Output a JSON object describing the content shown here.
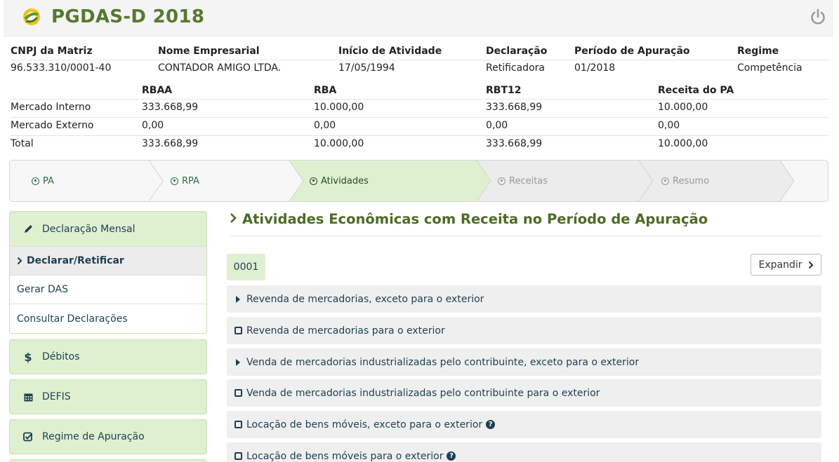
{
  "header": {
    "title": "PGDAS-D 2018",
    "logo_icon": "simples-nacional-logo",
    "power_icon": "power-icon",
    "accent": "#557a2f"
  },
  "info": {
    "headers": [
      "CNPJ da Matriz",
      "Nome Empresarial",
      "Início de Atividade",
      "Declaração",
      "Período de Apuração",
      "Regime"
    ],
    "values": [
      "96.533.310/0001-40",
      "CONTADOR AMIGO LTDA.",
      "17/05/1994",
      "Retificadora",
      "01/2018",
      "Competência"
    ]
  },
  "revenue": {
    "headers": [
      "RBAA",
      "RBA",
      "RBT12",
      "Receita do PA"
    ],
    "rows": [
      {
        "label": "Mercado Interno",
        "values": [
          "333.668,99",
          "10.000,00",
          "333.668,99",
          "10.000,00"
        ]
      },
      {
        "label": "Mercado Externo",
        "values": [
          "0,00",
          "0,00",
          "0,00",
          "0,00"
        ]
      },
      {
        "label": "Total",
        "values": [
          "333.668,99",
          "10.000,00",
          "333.668,99",
          "10.000,00"
        ]
      }
    ]
  },
  "steps": [
    {
      "label": "PA",
      "state": "done"
    },
    {
      "label": "RPA",
      "state": "done"
    },
    {
      "label": "Atividades",
      "state": "active"
    },
    {
      "label": "Receitas",
      "state": "todo"
    },
    {
      "label": "Resumo",
      "state": "todo"
    }
  ],
  "sidebar": {
    "declaracao": {
      "label": "Declaração Mensal",
      "icon": "pencil-icon"
    },
    "sub_items": [
      {
        "label": "Declarar/Retificar",
        "current": true
      },
      {
        "label": "Gerar DAS",
        "current": false
      },
      {
        "label": "Consultar Declarações",
        "current": false
      }
    ],
    "items": [
      {
        "label": "Débitos",
        "icon": "dollar-icon"
      },
      {
        "label": "DEFIS",
        "icon": "calendar-icon"
      },
      {
        "label": "Regime de Apuração",
        "icon": "check-square-icon"
      }
    ]
  },
  "main": {
    "title": "Atividades Econômicas com Receita no Período de Apuração",
    "establishment": "0001",
    "expand_label": "Expandir",
    "activities": [
      {
        "label": "Revenda de mercadorias, exceto para o exterior",
        "kind": "expandable",
        "help": false
      },
      {
        "label": "Revenda de mercadorias para o exterior",
        "kind": "checkbox",
        "help": false
      },
      {
        "label": "Venda de mercadorias industrializadas pelo contribuinte, exceto para o exterior",
        "kind": "expandable",
        "help": false
      },
      {
        "label": "Venda de mercadorias industrializadas pelo contribuinte para o exterior",
        "kind": "checkbox",
        "help": false
      },
      {
        "label": "Locação de bens móveis, exceto para o exterior",
        "kind": "checkbox",
        "help": true
      },
      {
        "label": "Locação de bens móveis para o exterior",
        "kind": "checkbox",
        "help": true
      }
    ]
  }
}
